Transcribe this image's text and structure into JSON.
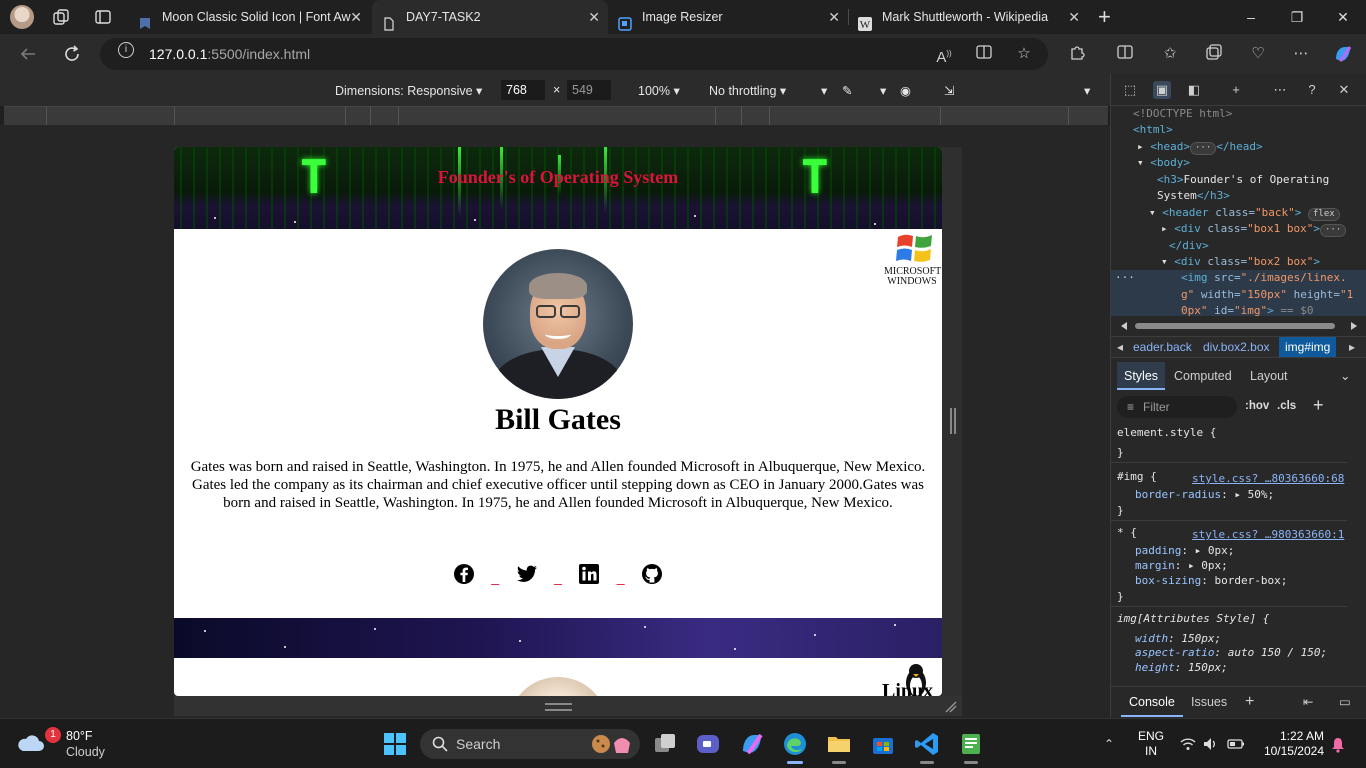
{
  "browser": {
    "tabs": [
      {
        "label": "Moon Classic Solid Icon | Font Aw",
        "icon": "flag-icon",
        "active": false
      },
      {
        "label": "DAY7-TASK2",
        "icon": "document-icon",
        "active": true
      },
      {
        "label": "Image Resizer",
        "icon": "resize-icon",
        "active": false
      },
      {
        "label": "Mark Shuttleworth - Wikipedia",
        "icon": "wikipedia-icon",
        "active": false
      }
    ],
    "close_glyph": "✕",
    "newtab_glyph": "+",
    "url_host": "127.0.0.1",
    "url_rest": ":5500/index.html",
    "window_controls": [
      "–",
      "❐",
      "✕"
    ]
  },
  "device_toolbar": {
    "dimensions_label": "Dimensions: Responsive",
    "width": "768",
    "times": "×",
    "height": "549",
    "zoom": "100%",
    "throttling": "No throttling"
  },
  "page": {
    "heading": "Founder's of Operating System",
    "logo_text_1": "MICROSOFT",
    "logo_text_2": "WINDOWS",
    "person_name": "Bill Gates",
    "bio": "Gates was born and raised in Seattle, Washington. In 1975, he and Allen founded Microsoft in Albuquerque, New Mexico. Gates led the company as its chairman and chief executive officer until stepping down as CEO in January 2000.Gates was born and raised in Seattle, Washington. In 1975, he and Allen founded Microsoft in Albuquerque, New Mexico.",
    "social_separator": "_",
    "socials": [
      "facebook-icon",
      "twitter-icon",
      "linkedin-icon",
      "github-icon"
    ],
    "linux_text": "Linux"
  },
  "devtools": {
    "dom": {
      "doctype": "<!DOCTYPE html>",
      "html": "<html>",
      "head_open": "<head>",
      "head_close": "</head>",
      "body": "<body>",
      "h3_open": "<h3>",
      "h3_text_1": "Founder's of Operating",
      "h3_text_2": "System",
      "h3_close": "</h3>",
      "header_open": "<header ",
      "header_attr": "class=",
      "header_val": "\"back\"",
      "header_end": ">",
      "flex_badge": "flex",
      "div1_open": "<div ",
      "div1_attr": "class=",
      "div1_val": "\"box1 box\"",
      "div1_end": ">",
      "div_close": "</div>",
      "div2_open": "<div ",
      "div2_attr": "class=",
      "div2_val": "\"box2 box\"",
      "div2_end": ">",
      "img_line_1_tag": "<img ",
      "img_line_1_attr": "src=",
      "img_line_1_val": "\"./images/linex.",
      "img_line_2_val": "g\"",
      "img_line_2_attr": " width=",
      "img_line_2_val2": "\"150px\"",
      "img_line_2_attr2": " height=",
      "img_line_2_val3": "\"1",
      "img_line_3_val": "0px\"",
      "img_line_3_attr": " id=",
      "img_line_3_val2": "\"img\"",
      "img_line_3_end": ">",
      "img_line_3_dollar": " == $0"
    },
    "breadcrumbs": [
      "eader.back",
      "div.box2.box",
      "img#img"
    ],
    "style_tabs": [
      "Styles",
      "Computed",
      "Layout"
    ],
    "filter_placeholder": "Filter",
    "hov": ":hov",
    "cls": ".cls",
    "rules": {
      "element_style": "element.style {",
      "brace_close": "}",
      "img_selector": "#img {",
      "img_link": "style.css? …80363660:68",
      "border_radius_prop": "border-radius",
      "border_radius_val": "50%;",
      "star_selector": "* {",
      "star_link": "style.css? …980363660:1",
      "padding_prop": "padding",
      "padding_val": "0px;",
      "margin_prop": "margin",
      "margin_val": "0px;",
      "boxsizing_prop": "box-sizing",
      "boxsizing_val": "border-box;",
      "attr_selector": "img[Attributes Style] {",
      "width_prop": "width",
      "width_val": "150px;",
      "aspect_prop": "aspect-ratio",
      "aspect_val": "auto 150 / 150;",
      "height_prop": "height",
      "height_val": "150px;"
    },
    "bottom_tabs": [
      "Console",
      "Issues"
    ]
  },
  "taskbar": {
    "weather_badge": "1",
    "weather_temp": "80°F",
    "weather_desc": "Cloudy",
    "search_label": "Search",
    "lang_1": "ENG",
    "lang_2": "IN",
    "time": "1:22 AM",
    "date": "10/15/2024"
  },
  "colors": {
    "heading_red": "#dc143c",
    "accent_blue": "#8ab4f8",
    "matrix_green": "#3cff3c"
  }
}
